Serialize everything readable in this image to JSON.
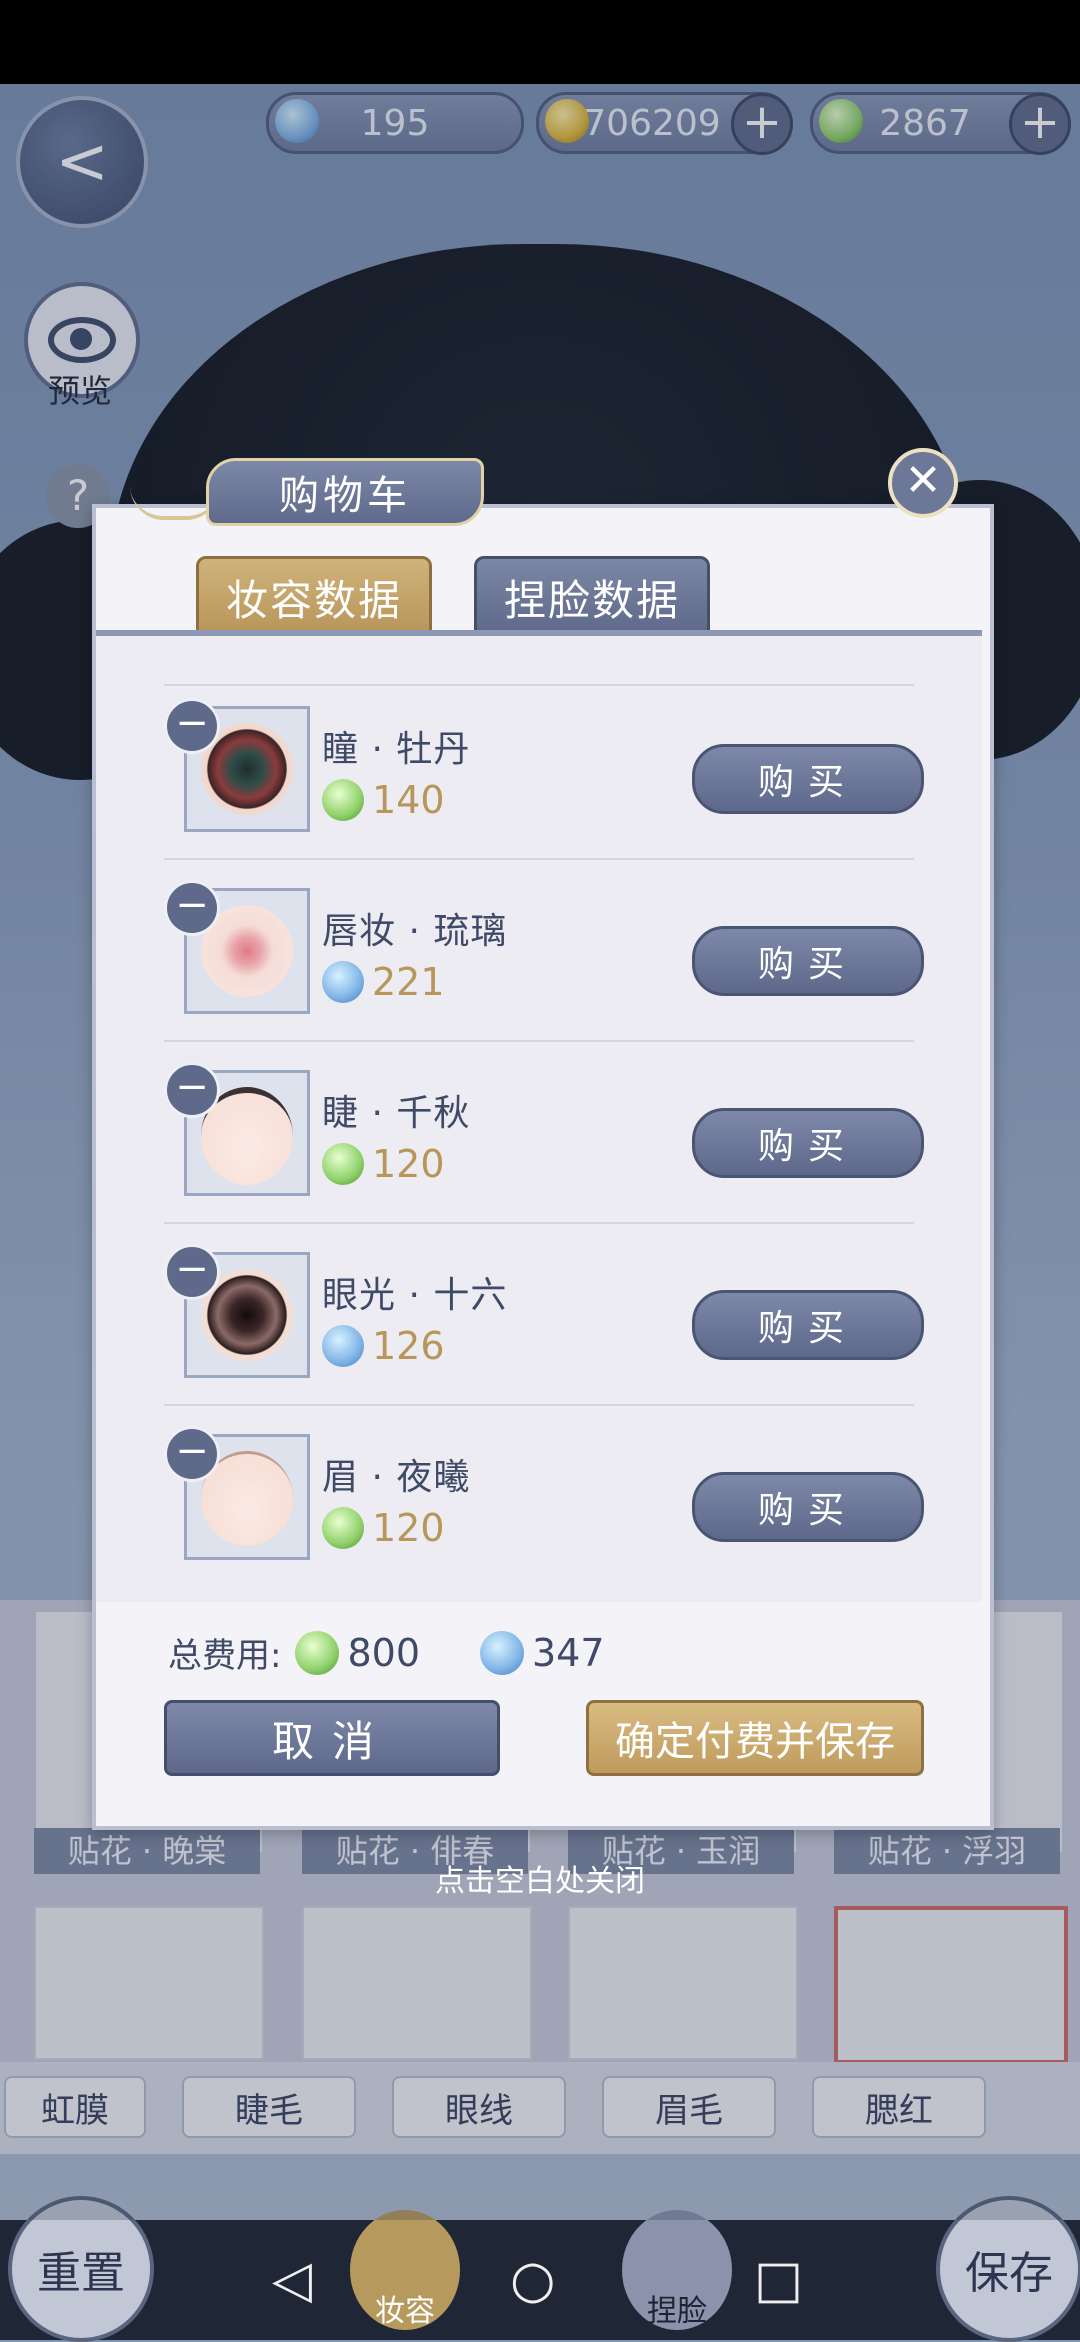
{
  "currency": {
    "jade": "195",
    "coins": "706209",
    "leaves": "2867",
    "plus": "+"
  },
  "sidebar": {
    "back_glyph": "<",
    "preview_label": "预览",
    "help_glyph": "?"
  },
  "modal": {
    "title": "购物车",
    "close_glyph": "✕",
    "tabs": [
      {
        "label": "妆容数据",
        "active": true
      },
      {
        "label": "捏脸数据",
        "active": false
      }
    ],
    "items": [
      {
        "name": "瞳 · 牡丹",
        "price": "140",
        "currency": "leaf-icon",
        "button": "购买",
        "remove": "−"
      },
      {
        "name": "唇妆 · 琉璃",
        "price": "221",
        "currency": "jade-icon",
        "button": "购买",
        "remove": "−"
      },
      {
        "name": "睫 · 千秋",
        "price": "120",
        "currency": "leaf-icon",
        "button": "购买",
        "remove": "−"
      },
      {
        "name": "眼光 · 十六",
        "price": "126",
        "currency": "jade-icon",
        "button": "购买",
        "remove": "−"
      },
      {
        "name": "眉 · 夜曦",
        "price": "120",
        "currency": "leaf-icon",
        "button": "购买",
        "remove": "−"
      }
    ],
    "total_label": "总费用:",
    "total_leaf": "800",
    "total_jade": "347",
    "cancel_label": "取消",
    "confirm_label": "确定付费并保存"
  },
  "close_hint": "点击空白处关闭",
  "background": {
    "card_labels": [
      "贴花 · 晚棠",
      "贴花 · 俳春",
      "贴花 · 玉润",
      "贴花 · 浮羽"
    ],
    "category_tabs": [
      "虹膜",
      "睫毛",
      "眼线",
      "眉毛",
      "腮红"
    ],
    "reset_label": "重置",
    "save_label": "保存",
    "makeup_tab": "妆容",
    "face_tab": "捏脸"
  },
  "system_nav": {
    "back": "◁",
    "home": "○",
    "recents": "□"
  },
  "colors": {
    "accent_gold": "#b8955a",
    "button_slate": "#5d688a"
  }
}
